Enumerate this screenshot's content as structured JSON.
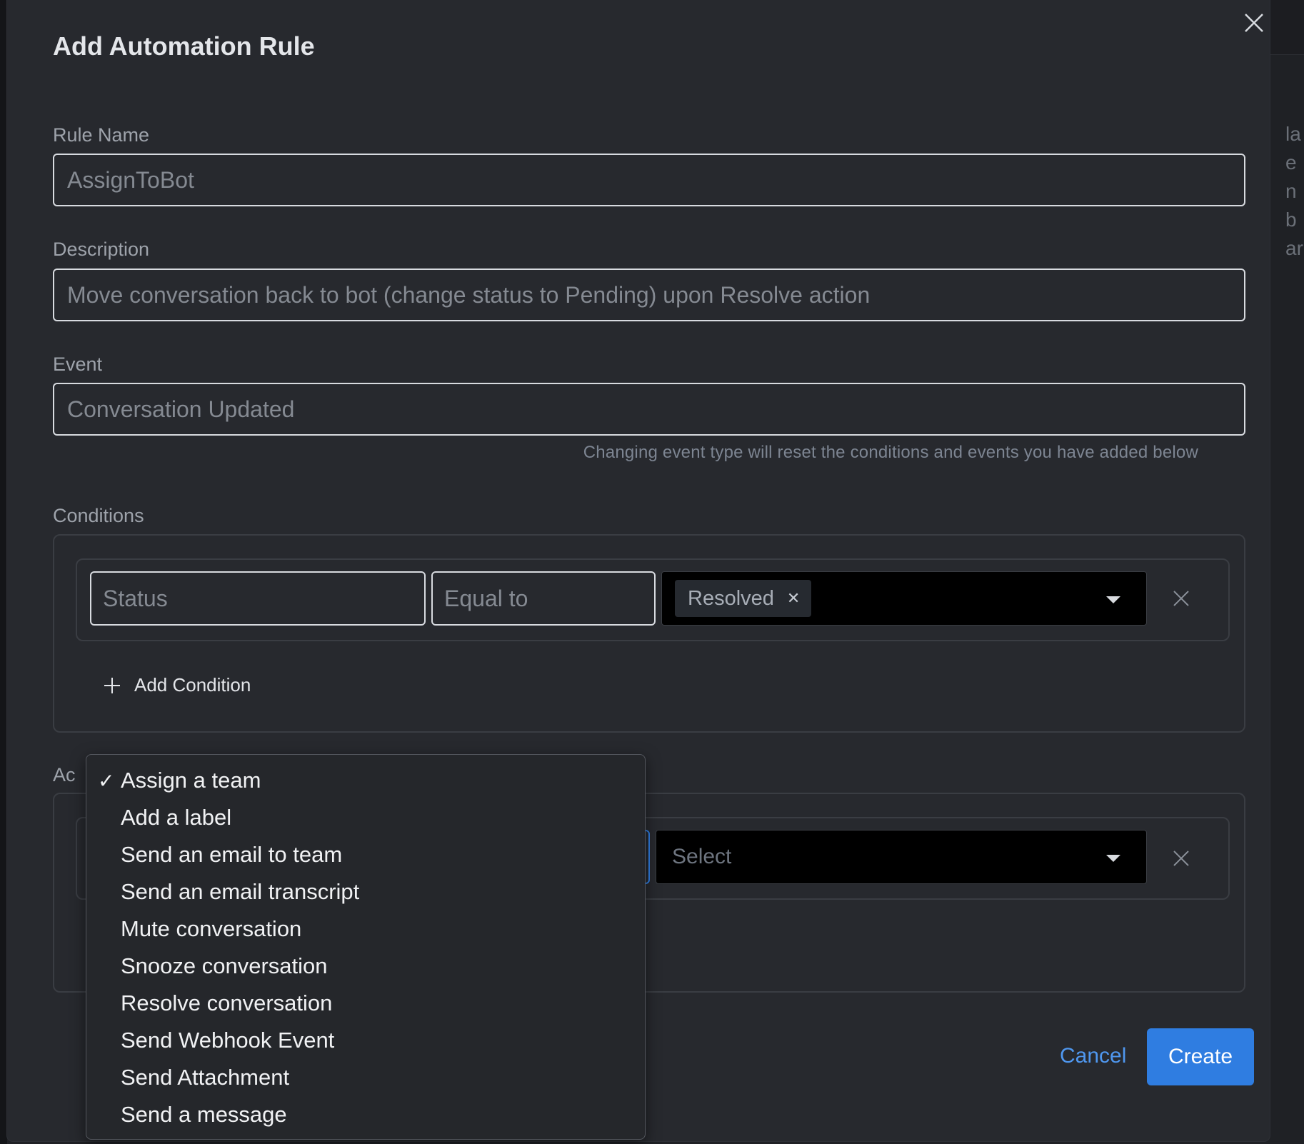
{
  "modal": {
    "title": "Add Automation Rule",
    "rule_name": {
      "label": "Rule Name",
      "value": "AssignToBot"
    },
    "description": {
      "label": "Description",
      "value": "Move conversation back to bot (change status to Pending) upon Resolve action"
    },
    "event": {
      "label": "Event",
      "value": "Conversation Updated",
      "hint": "Changing event type will reset the conditions and events you have added below"
    },
    "conditions": {
      "label": "Conditions",
      "attribute": "Status",
      "operator": "Equal to",
      "value_tag": "Resolved",
      "add_label": "Add Condition"
    },
    "actions": {
      "label_partial": "Ac",
      "value_placeholder": "Select",
      "dropdown_options": [
        {
          "label": "Assign a team",
          "selected": true
        },
        {
          "label": "Add a label"
        },
        {
          "label": "Send an email to team"
        },
        {
          "label": "Send an email transcript"
        },
        {
          "label": "Mute conversation"
        },
        {
          "label": "Snooze conversation"
        },
        {
          "label": "Resolve conversation"
        },
        {
          "label": "Send Webhook Event"
        },
        {
          "label": "Send Attachment"
        },
        {
          "label": "Send a message"
        }
      ]
    },
    "footer": {
      "cancel_label": "Cancel",
      "create_label": "Create"
    }
  },
  "background_peek": [
    "la",
    "e",
    "n",
    "b",
    "ar"
  ],
  "colors": {
    "accent": "#2f7de1",
    "link": "#4f97ef",
    "modal_bg": "#27292e"
  }
}
